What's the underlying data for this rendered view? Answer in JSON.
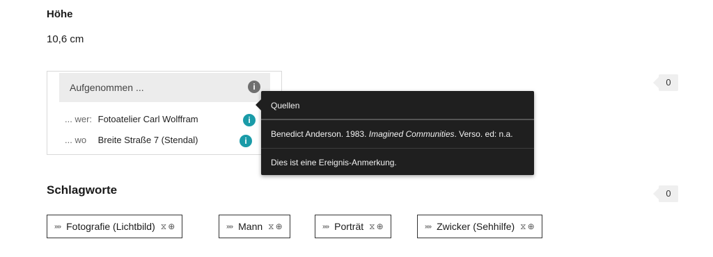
{
  "dimension": {
    "label": "Höhe",
    "value": "10,6 cm"
  },
  "event": {
    "heading": "Aufgenommen ...",
    "rows": [
      {
        "key": "... wer:",
        "value": "Fotoatelier Carl Wolffram"
      },
      {
        "key": "... wo",
        "value": "Breite Straße 7 (Stendal)"
      }
    ],
    "count": "0"
  },
  "tooltip": {
    "title": "Quellen",
    "source_prefix": "Benedict Anderson. 1983. ",
    "source_italic": "Imagined Communities",
    "source_suffix": ". Verso. ed: n.a.",
    "note": "Dies ist eine Ereignis-Anmerkung."
  },
  "keywords": {
    "title": "Schlagworte",
    "count": "0",
    "tags": [
      {
        "label": "Fotografie (Lichtbild)"
      },
      {
        "label": "Mann"
      },
      {
        "label": "Porträt"
      },
      {
        "label": "Zwicker (Sehhilfe)"
      }
    ]
  },
  "icons": {
    "info": "info-icon",
    "chevron": "double-chevron-icon",
    "time": "hourglass-icon",
    "globe": "globe-icon"
  },
  "colors": {
    "info_teal": "#1a9ba8",
    "tooltip_bg": "#1f1f1f",
    "header_bg": "#ececec"
  }
}
